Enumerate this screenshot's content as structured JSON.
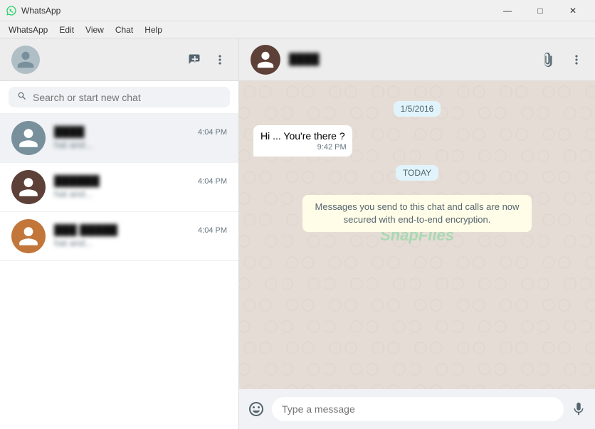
{
  "window": {
    "title": "WhatsApp",
    "icon": "whatsapp-icon",
    "controls": {
      "minimize": "—",
      "maximize": "□",
      "close": "✕"
    }
  },
  "menubar": {
    "items": [
      "WhatsApp",
      "Edit",
      "View",
      "Chat",
      "Help"
    ]
  },
  "left_header": {
    "new_chat_label": "+",
    "more_options_label": "···"
  },
  "search": {
    "placeholder": "Search or start new chat"
  },
  "chat_list": [
    {
      "name": "████",
      "preview": "hat and...",
      "time": "4:04 PM",
      "avatar_class": "avatar-1"
    },
    {
      "name": "██████",
      "preview": "hat and...",
      "time": "4:04 PM",
      "avatar_class": "avatar-2"
    },
    {
      "name": "███ █████",
      "preview": "hat and...",
      "time": "4:04 PM",
      "avatar_class": "avatar-3"
    }
  ],
  "right_header": {
    "contact_name": "████",
    "attach_icon": "📎",
    "more_options": "···"
  },
  "chat": {
    "date_badge_1": "1/5/2016",
    "message_1": {
      "text": "Hi ... You're there ?",
      "time": "9:42 PM",
      "type": "received"
    },
    "date_badge_2": "TODAY",
    "encryption_notice": "Messages you send to this chat and calls are now secured with end-to-end encryption."
  },
  "input": {
    "placeholder": "Type a message",
    "emoji": "😊",
    "mic": "🎤"
  },
  "watermark": "SnapFiles"
}
